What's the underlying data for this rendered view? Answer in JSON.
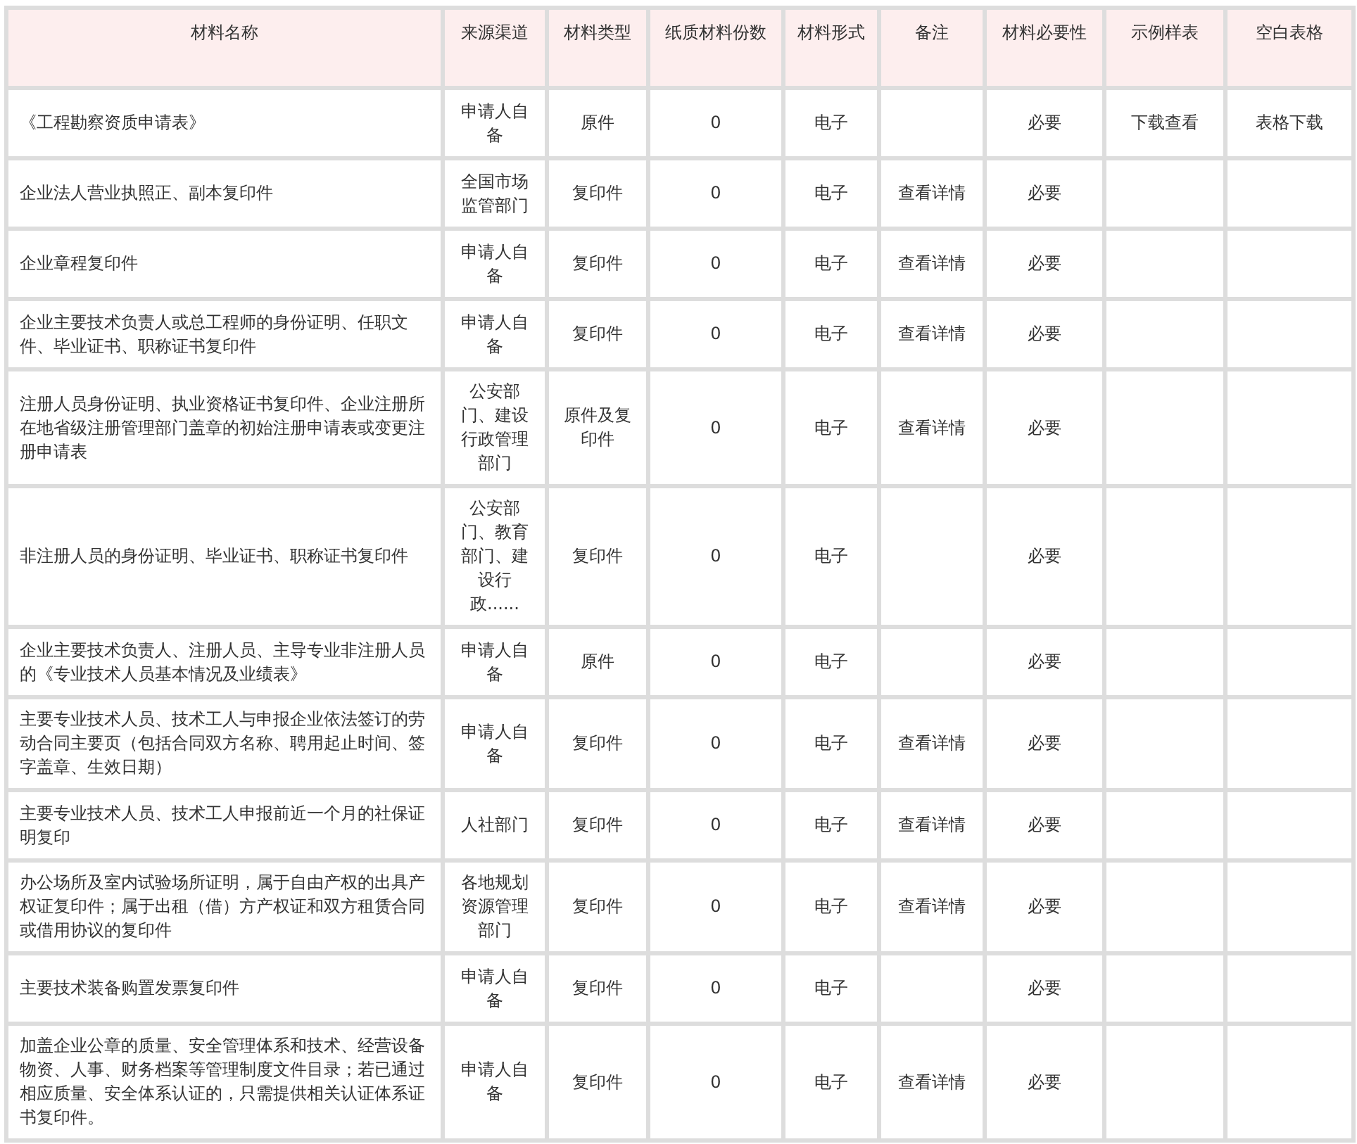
{
  "table": {
    "columns": [
      "材料名称",
      "来源渠道",
      "材料类型",
      "纸质材料份数",
      "材料形式",
      "备注",
      "材料必要性",
      "示例样表",
      "空白表格"
    ],
    "rows": [
      {
        "name": "《工程勘察资质申请表》",
        "source": "申请人自备",
        "type": "原件",
        "paper_count": "0",
        "form": "电子",
        "necessity": "必要",
        "sample_link": "下载查看",
        "blank_link": "表格下载"
      },
      {
        "name": "企业法人营业执照正、副本复印件",
        "source": "全国市场监管部门",
        "type": "复印件",
        "paper_count": "0",
        "form": "电子",
        "note_link": "查看详情",
        "necessity": "必要"
      },
      {
        "name": "企业章程复印件",
        "source": "申请人自备",
        "type": "复印件",
        "paper_count": "0",
        "form": "电子",
        "note_link": "查看详情",
        "necessity": "必要"
      },
      {
        "name": "企业主要技术负责人或总工程师的身份证明、任职文件、毕业证书、职称证书复印件",
        "source": "申请人自备",
        "type": "复印件",
        "paper_count": "0",
        "form": "电子",
        "note_link": "查看详情",
        "necessity": "必要"
      },
      {
        "name": "注册人员身份证明、执业资格证书复印件、企业注册所在地省级注册管理部门盖章的初始注册申请表或变更注册申请表",
        "source": "公安部门、建设行政管理部门",
        "type": "原件及复印件",
        "paper_count": "0",
        "form": "电子",
        "note_link": "查看详情",
        "necessity": "必要"
      },
      {
        "name": "非注册人员的身份证明、毕业证书、职称证书复印件",
        "source": "公安部门、教育部门、建设行政......",
        "type": "复印件",
        "paper_count": "0",
        "form": "电子",
        "necessity": "必要"
      },
      {
        "name": "企业主要技术负责人、注册人员、主导专业非注册人员的《专业技术人员基本情况及业绩表》",
        "source": "申请人自备",
        "type": "原件",
        "paper_count": "0",
        "form": "电子",
        "necessity": "必要"
      },
      {
        "name": "主要专业技术人员、技术工人与申报企业依法签订的劳动合同主要页（包括合同双方名称、聘用起止时间、签字盖章、生效日期）",
        "source": "申请人自备",
        "type": "复印件",
        "paper_count": "0",
        "form": "电子",
        "note_link": "查看详情",
        "necessity": "必要"
      },
      {
        "name": "主要专业技术人员、技术工人申报前近一个月的社保证明复印",
        "source": "人社部门",
        "type": "复印件",
        "paper_count": "0",
        "form": "电子",
        "note_link": "查看详情",
        "necessity": "必要"
      },
      {
        "name": "办公场所及室内试验场所证明，属于自由产权的出具产权证复印件；属于出租（借）方产权证和双方租赁合同或借用协议的复印件",
        "source": "各地规划资源管理部门",
        "type": "复印件",
        "paper_count": "0",
        "form": "电子",
        "note_link": "查看详情",
        "necessity": "必要"
      },
      {
        "name": "主要技术装备购置发票复印件",
        "source": "申请人自备",
        "type": "复印件",
        "paper_count": "0",
        "form": "电子",
        "necessity": "必要"
      },
      {
        "name": "加盖企业公章的质量、安全管理体系和技术、经营设备物资、人事、财务档案等管理制度文件目录；若已通过相应质量、安全体系认证的，只需提供相关认证体系证书复印件。",
        "source": "申请人自备",
        "type": "复印件",
        "paper_count": "0",
        "form": "电子",
        "note_link": "查看详情",
        "necessity": "必要"
      }
    ]
  }
}
